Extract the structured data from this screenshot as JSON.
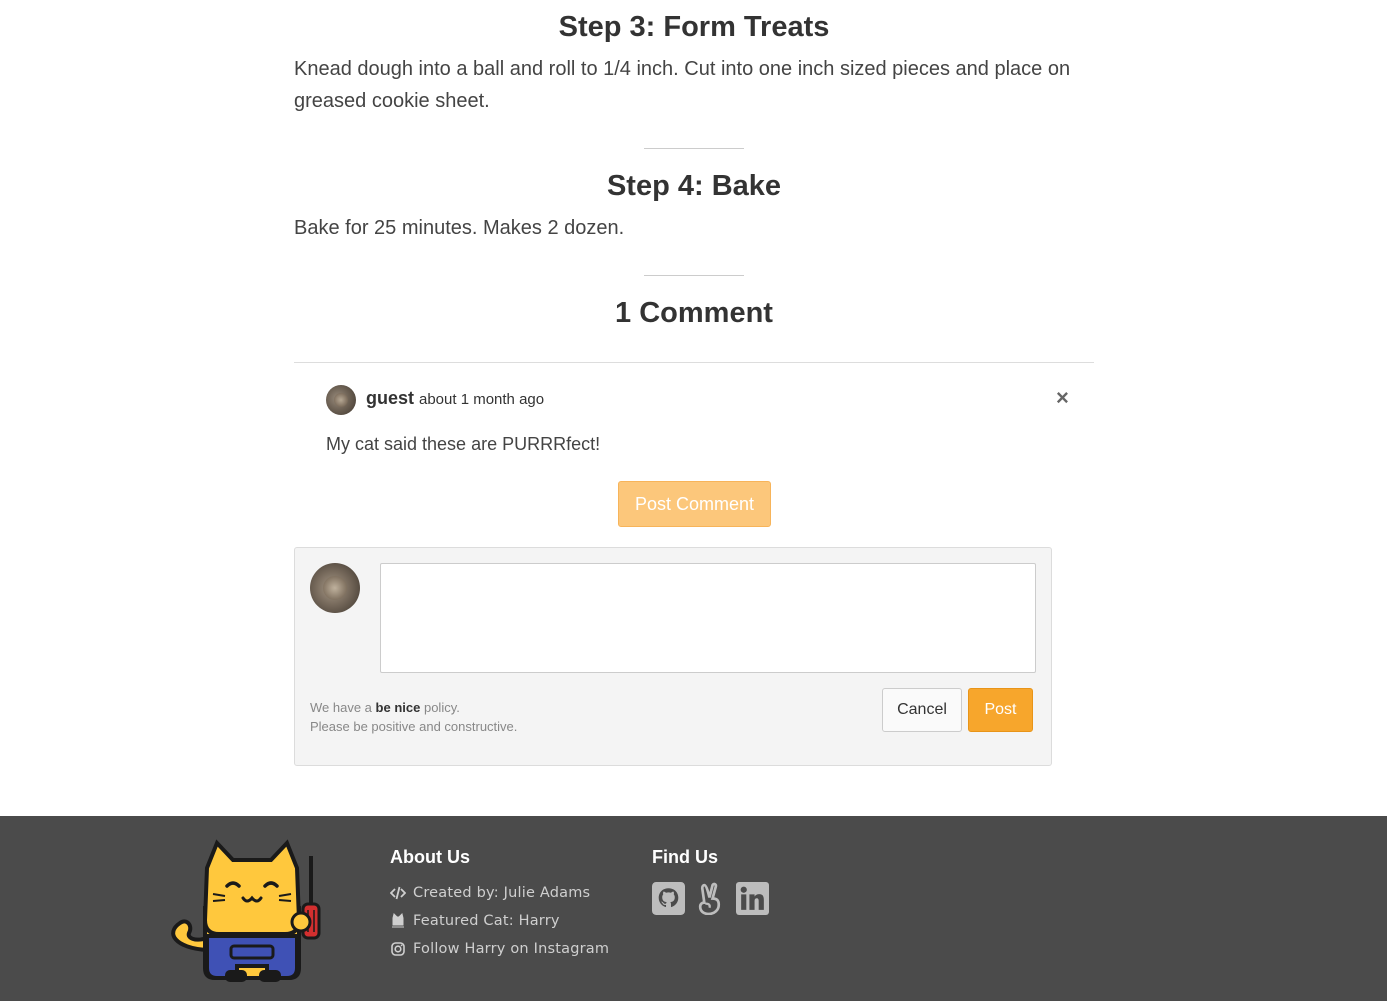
{
  "steps": [
    {
      "title": "Step 3: Form Treats",
      "text": "Knead dough into a ball and roll to 1/4 inch. Cut into one inch sized pieces and place on greased cookie sheet."
    },
    {
      "title": "Step 4: Bake",
      "text": "Bake for 25 minutes. Makes 2 dozen."
    }
  ],
  "comments": {
    "heading": "1 Comment",
    "items": [
      {
        "author": "guest",
        "time": "about 1 month ago",
        "body": "My cat said these are PURRRfect!",
        "close": "×"
      }
    ],
    "post_comment_label": "Post Comment"
  },
  "form": {
    "policy_prefix": "We have a",
    "policy_bold": "be nice",
    "policy_suffix": "policy.",
    "policy_line2": "Please be positive and constructive.",
    "cancel_label": "Cancel",
    "post_label": "Post"
  },
  "footer": {
    "about_title": "About Us",
    "about_items": [
      "Created by: Julie Adams",
      "Featured Cat: Harry",
      "Follow Harry on Instagram"
    ],
    "find_title": "Find Us",
    "social_icons": [
      "github-icon",
      "angellist-icon",
      "linkedin-icon"
    ]
  },
  "colors": {
    "accent": "#f7a62c",
    "accent_light": "#fcc77b",
    "footer_bg": "#4b4b4b",
    "mascot_yellow": "#ffc83d",
    "mascot_overalls": "#3f51b5"
  }
}
